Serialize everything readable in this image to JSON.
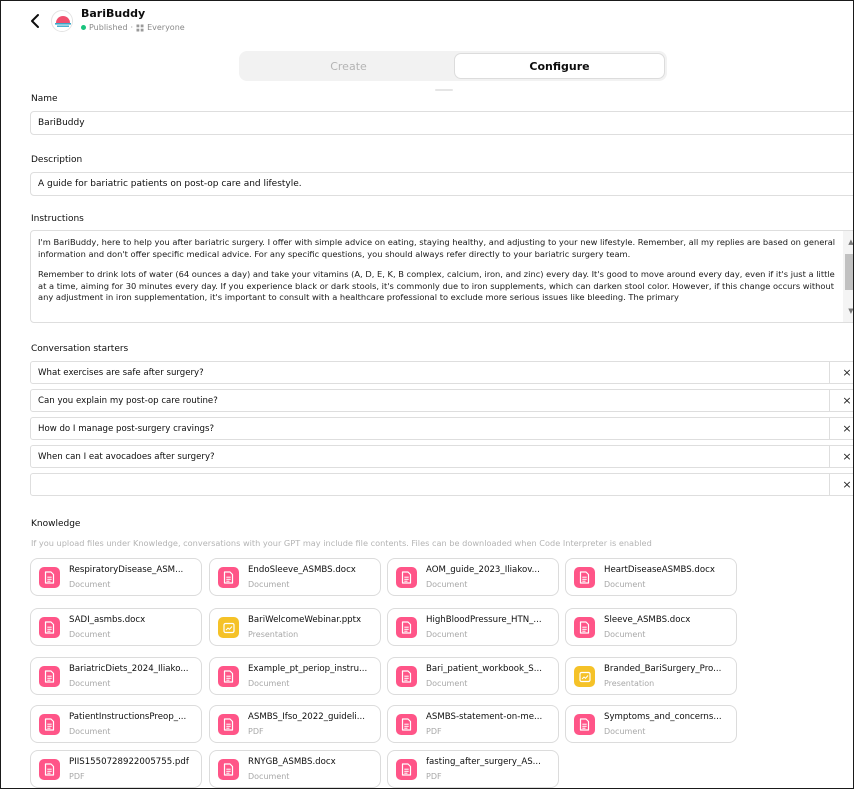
{
  "header": {
    "gpt_name": "BariBuddy",
    "status": "Published",
    "separator": "·",
    "audience": "Everyone"
  },
  "tabs": {
    "create": "Create",
    "configure": "Configure",
    "active": "Configure"
  },
  "form": {
    "name_label": "Name",
    "name_value": "BariBuddy",
    "description_label": "Description",
    "description_value": "A guide for bariatric patients on post-op care and lifestyle.",
    "instructions_label": "Instructions",
    "instructions_p1": "I'm BariBuddy, here to help you after bariatric surgery.  I offer with simple advice on eating, staying healthy, and adjusting to your new lifestyle. Remember, all my replies are based on general information and don't offer specific medical advice. For any specific questions, you should always refer directly to your bariatric surgery team.",
    "instructions_p2": "Remember to drink lots of water (64 ounces a day) and take your vitamins (A, D, E, K, B complex, calcium, iron, and zinc) every day. It's good to move around every day, even if it's just a little at a time, aiming for 30 minutes every day. If you experience black or dark stools, it's commonly due to iron supplements, which can darken stool color. However, if this change occurs without any adjustment in iron supplementation, it's important to consult with a healthcare professional to exclude more serious issues like bleeding.  The primary",
    "starters_label": "Conversation starters",
    "starters": [
      "What exercises are safe after surgery?",
      "Can you explain my post-op care routine?",
      "How do I manage post-surgery cravings?",
      "When can I eat avocadoes after surgery?",
      ""
    ],
    "remove_glyph": "×",
    "knowledge_label": "Knowledge",
    "knowledge_note": "If you upload files under Knowledge, conversations with your GPT may include file contents. Files can be downloaded when Code Interpreter is enabled"
  },
  "files": [
    {
      "name": "RespiratoryDisease_ASM...",
      "type": "Document",
      "icon": "document-icon"
    },
    {
      "name": "EndoSleeve_ASMBS.docx",
      "type": "Document",
      "icon": "document-icon"
    },
    {
      "name": "AOM_guide_2023_Iliakov...",
      "type": "Document",
      "icon": "document-icon"
    },
    {
      "name": "HeartDiseaseASMBS.docx",
      "type": "Document",
      "icon": "document-icon"
    },
    {
      "name": "SADI_asmbs.docx",
      "type": "Document",
      "icon": "document-icon"
    },
    {
      "name": "BariWelcomeWebinar.pptx",
      "type": "Presentation",
      "icon": "presentation-icon"
    },
    {
      "name": "HighBloodPressure_HTN_...",
      "type": "Document",
      "icon": "document-icon"
    },
    {
      "name": "Sleeve_ASMBS.docx",
      "type": "Document",
      "icon": "document-icon"
    },
    {
      "name": "BariatricDiets_2024_Iliako...",
      "type": "Document",
      "icon": "document-icon"
    },
    {
      "name": "Example_pt_periop_instru...",
      "type": "Document",
      "icon": "document-icon"
    },
    {
      "name": "Bari_patient_workbook_S...",
      "type": "Document",
      "icon": "document-icon"
    },
    {
      "name": "Branded_BariSurgery_Pro...",
      "type": "Presentation",
      "icon": "presentation-icon"
    },
    {
      "name": "PatientInstructionsPreop_...",
      "type": "Document",
      "icon": "document-icon"
    },
    {
      "name": "ASMBS_Ifso_2022_guideli...",
      "type": "PDF",
      "icon": "document-icon"
    },
    {
      "name": "ASMBS-statement-on-me...",
      "type": "PDF",
      "icon": "document-icon"
    },
    {
      "name": "Symptoms_and_concerns...",
      "type": "Document",
      "icon": "document-icon"
    },
    {
      "name": "PIIS1550728922005755.pdf",
      "type": "PDF",
      "icon": "document-icon"
    },
    {
      "name": "RNYGB_ASMBS.docx",
      "type": "Document",
      "icon": "document-icon"
    },
    {
      "name": "fasting_after_surgery_AS...",
      "type": "PDF",
      "icon": "document-icon"
    }
  ],
  "colors": {
    "doc_icon": "#ff5588",
    "presentation_icon": "#f5c228",
    "published_dot": "#19c37d"
  }
}
